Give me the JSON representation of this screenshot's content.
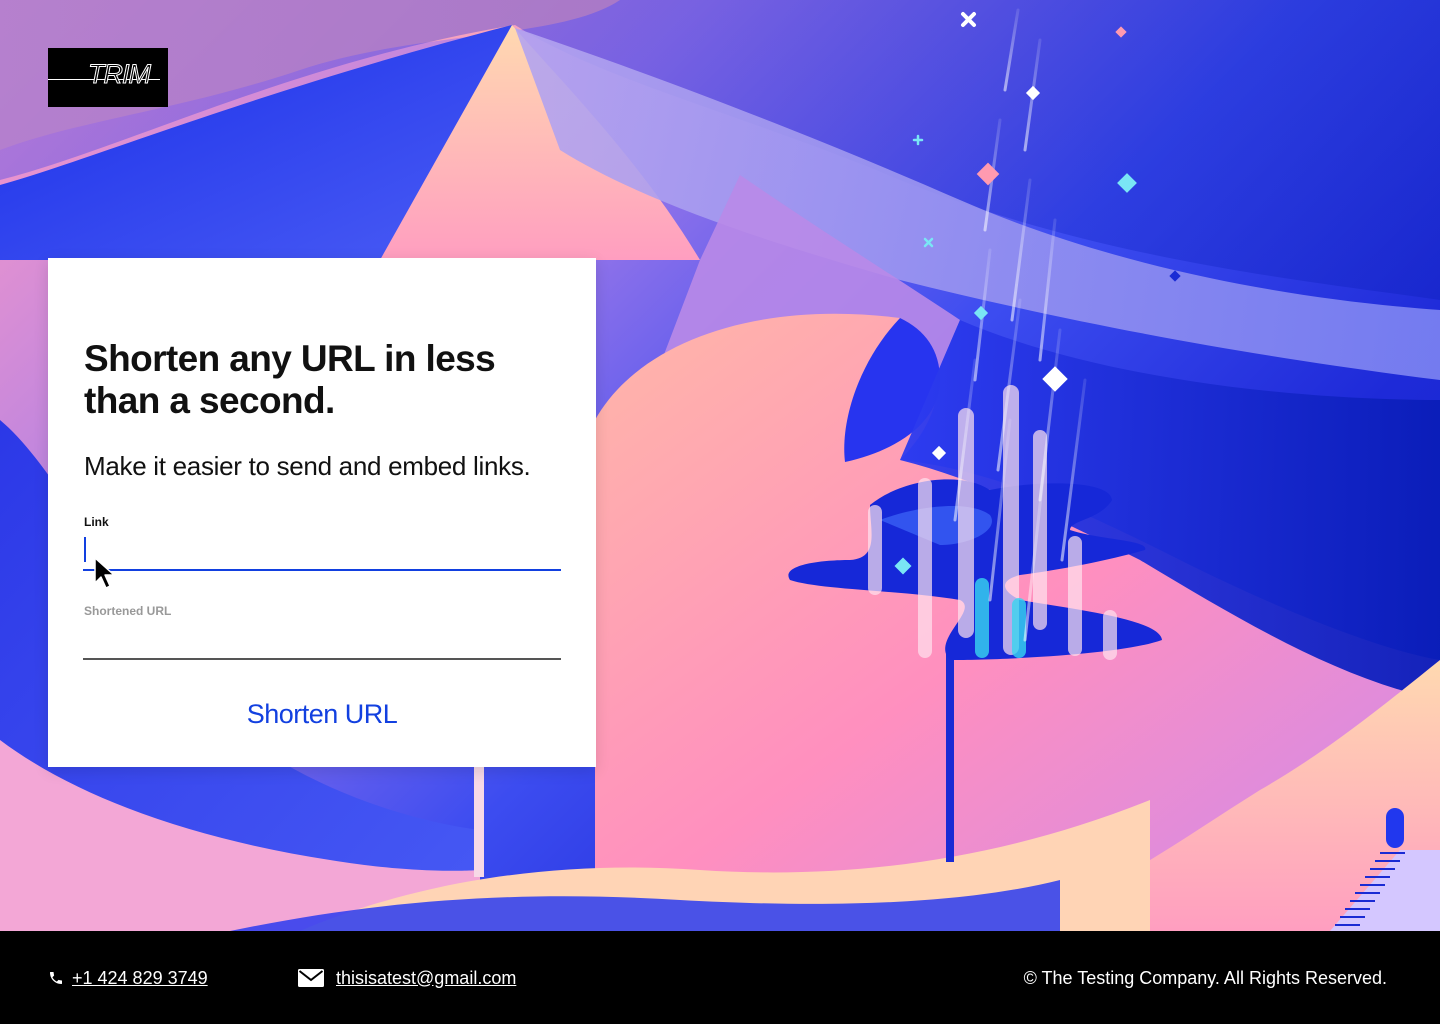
{
  "brand": {
    "logo_text": "TRIM"
  },
  "card": {
    "headline": "Shorten any URL in less than a second.",
    "subhead": "Make it easier to send and embed links.",
    "link_label": "Link",
    "link_value": "",
    "shortened_label": "Shortened URL",
    "shortened_value": "",
    "button_label": "Shorten URL"
  },
  "footer": {
    "phone": "+1 424 829 3749",
    "email": "thisisatest@gmail.com",
    "copyright": "© The Testing Company. All Rights Reserved."
  },
  "icons": {
    "phone": "phone-icon",
    "email": "envelope-icon",
    "cursor": "mouse-pointer-icon"
  },
  "colors": {
    "accent": "#1240E0",
    "footer_bg": "#000000",
    "card_bg": "#FFFFFF"
  }
}
